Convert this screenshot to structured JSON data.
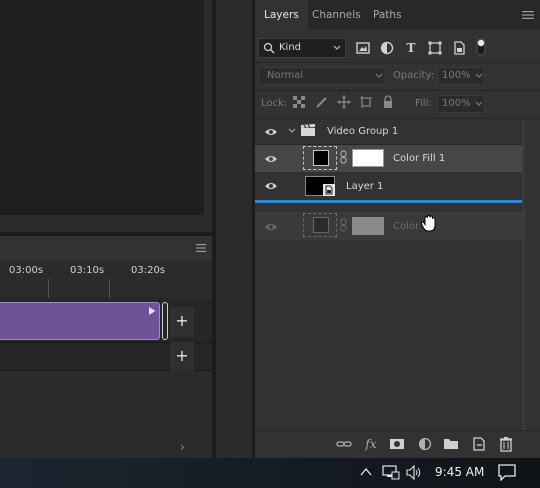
{
  "timeline": {
    "ticks": [
      "03:00s",
      "03:10s",
      "03:20s"
    ],
    "add_label": "+"
  },
  "layers_panel": {
    "tabs": [
      {
        "label": "Layers",
        "active": true
      },
      {
        "label": "Channels",
        "active": false
      },
      {
        "label": "Paths",
        "active": false
      }
    ],
    "filter_label": "Kind",
    "blend_mode": "Normal",
    "opacity_label": "Opacity:",
    "opacity_value": "100%",
    "lock_label": "Lock:",
    "fill_label": "Fill:",
    "fill_value": "100%",
    "layers": [
      {
        "name": "Video Group 1",
        "type": "video-group"
      },
      {
        "name": "Color Fill 1",
        "type": "fill",
        "selected": true
      },
      {
        "name": "Layer 1",
        "type": "smart"
      },
      {
        "name": "Color Fill 1",
        "type": "fill-ghost",
        "display": "Color Fi"
      }
    ]
  },
  "taskbar": {
    "clock": "9:45 AM"
  },
  "colors": {
    "accent_blue": "#2f86d6",
    "clip_purple": "#6e5399",
    "panel_bg": "#323232"
  }
}
